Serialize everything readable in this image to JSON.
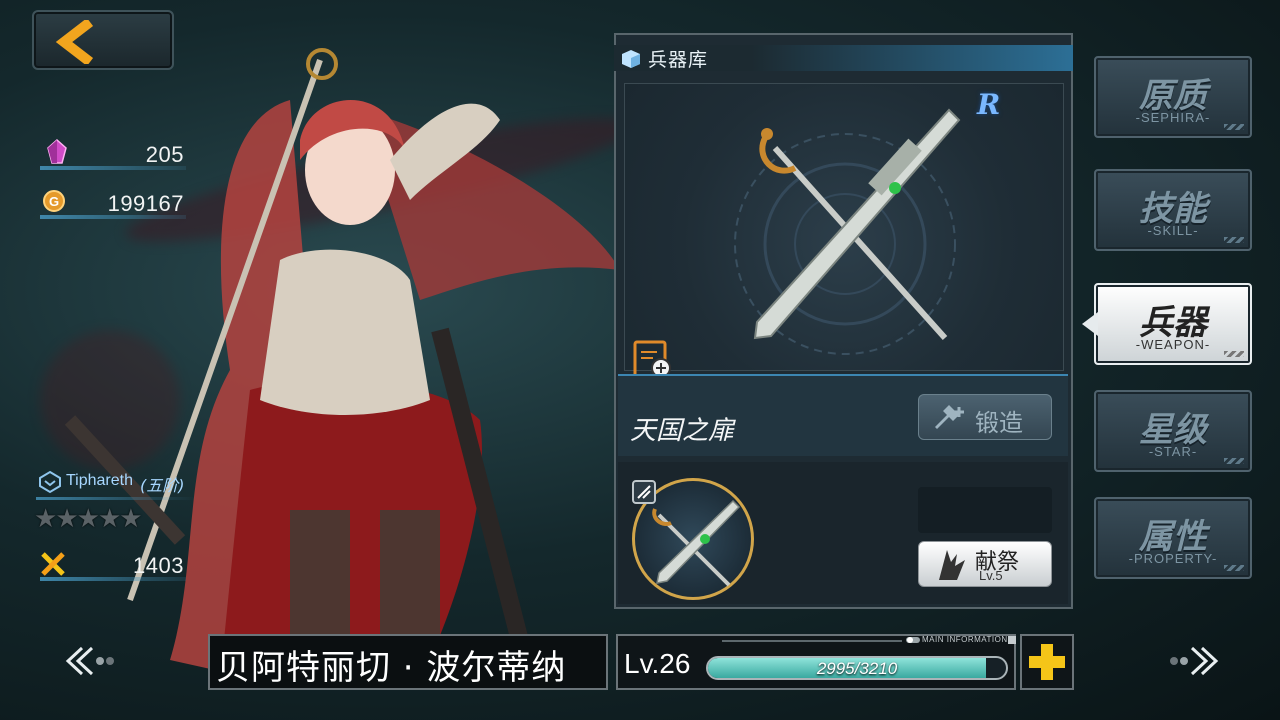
{
  "header": {
    "back_icon": "back-arrow-icon"
  },
  "resources": {
    "crystal": {
      "icon": "pink-crystal-icon",
      "value": "205"
    },
    "gold": {
      "icon": "gold-coin-icon",
      "value": "199167"
    }
  },
  "character": {
    "rank_name": "Tiphareth",
    "rank_tier": "(五阶)",
    "stars_total": 5,
    "stars_filled": 0,
    "power_icon": "crossed-swords-icon",
    "power": "1403",
    "name": "贝阿特丽切 · 波尔蒂纳",
    "level": "Lv.26",
    "exp_text": "2995/3210",
    "exp_fraction": 0.933
  },
  "arsenal": {
    "title": "兵器库",
    "rarity": "R",
    "weapon_name": "天国之扉",
    "forge_label": "锻造",
    "sacrifice_label": "献祭",
    "sacrifice_level": "Lv.5"
  },
  "bottom": {
    "main_info_label": "MAIN INFORMATION"
  },
  "tabs": [
    {
      "cn": "原质",
      "en": "-SEPHIRA-",
      "active": false
    },
    {
      "cn": "技能",
      "en": "-SKILL-",
      "active": false
    },
    {
      "cn": "兵器",
      "en": "-WEAPON-",
      "active": true
    },
    {
      "cn": "星级",
      "en": "-STAR-",
      "active": false
    },
    {
      "cn": "属性",
      "en": "-PROPERTY-",
      "active": false
    }
  ],
  "colors": {
    "accent_blue": "#2c6f96",
    "exp_fill": "#3aa9a0",
    "back_arrow": "#f2a51e",
    "plus": "#f5c518"
  }
}
